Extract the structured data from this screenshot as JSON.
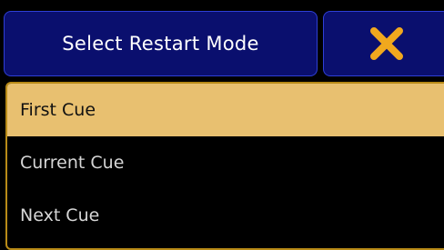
{
  "dialog": {
    "title": "Select Restart Mode",
    "close_icon": "close-x-icon"
  },
  "options": [
    {
      "label": "First Cue",
      "selected": true
    },
    {
      "label": "Current Cue",
      "selected": false
    },
    {
      "label": "Next Cue",
      "selected": false
    }
  ],
  "colors": {
    "title_background": "#0a0f6e",
    "title_border": "#2f3fd6",
    "close_icon": "#f0a81e",
    "panel_border": "#b88a17",
    "selected_background": "#e8c070",
    "background": "#000000"
  }
}
